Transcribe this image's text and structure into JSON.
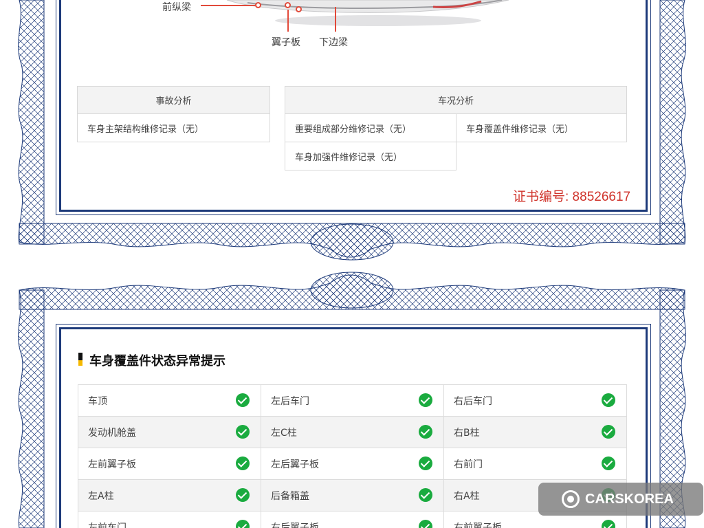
{
  "diagram": {
    "labels": [
      "前纵梁",
      "翼子板",
      "下边梁"
    ]
  },
  "accident": {
    "header": "事故分析",
    "items": [
      "车身主架结构维修记录（无）"
    ]
  },
  "condition": {
    "header": "车况分析",
    "items": [
      "重要组成部分维修记录（无）",
      "车身覆盖件维修记录（无）",
      "车身加强件维修记录（无）"
    ]
  },
  "certificate": {
    "number": "证书编号: 88526617"
  },
  "body_panels": {
    "title": "车身覆盖件状态异常提示",
    "rows": [
      [
        "车顶",
        "左后车门",
        "右后车门"
      ],
      [
        "发动机舱盖",
        "左C柱",
        "右B柱"
      ],
      [
        "左前翼子板",
        "左后翼子板",
        "右前门"
      ],
      [
        "左A柱",
        "后备箱盖",
        "右A柱"
      ],
      [
        "左前车门",
        "右后翼子板",
        "右前翼子板"
      ]
    ],
    "status_icon": "check-circle-icon",
    "status_color": "#1aab3f"
  },
  "watermark": {
    "text": "CARSKOREA",
    "icon": "carskorea-logo-icon"
  },
  "colors": {
    "border": "#1d3a7a",
    "cert_number": "#d0342c",
    "accent_bar": "#f5b800"
  }
}
